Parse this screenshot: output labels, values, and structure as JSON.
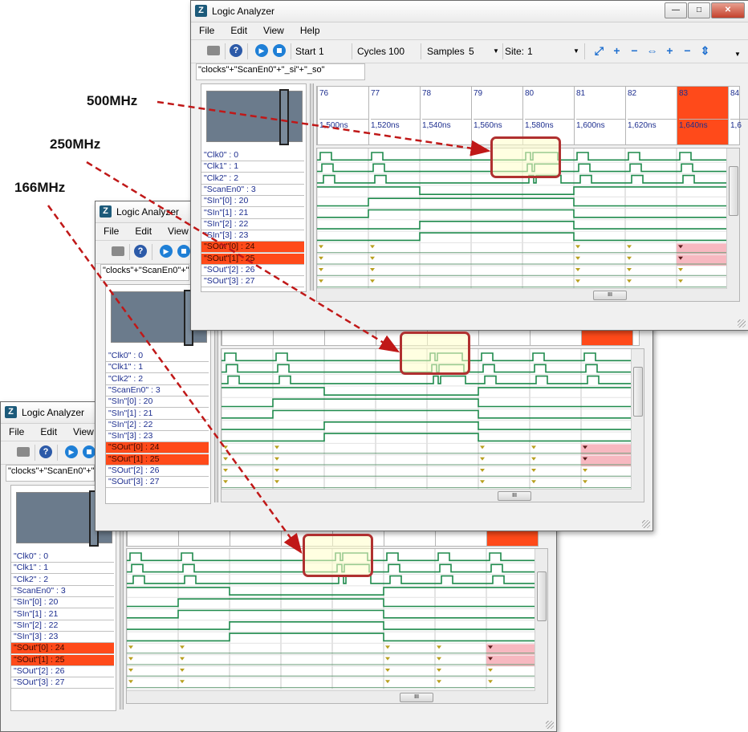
{
  "app_title": "Logic Analyzer",
  "callouts": [
    "500MHz",
    "250MHz",
    "166MHz"
  ],
  "menus": [
    "File",
    "Edit",
    "View",
    "Help"
  ],
  "toolbar": {
    "start_label": "Start",
    "start_value": "1",
    "cycles_label": "Cycles",
    "cycles_value": "100",
    "samples_label": "Samples",
    "samples_value": "5",
    "site_label": "Site:",
    "site_value": "1"
  },
  "expression": "\"clocks\"+\"ScanEn0\"+\"_si\"+\"_so\"",
  "expression_short": "\"clocks\"+\"ScanEn0\"+\"_",
  "signals": [
    "\"Clk0\" : 0",
    "\"Clk1\" : 1",
    "\"Clk2\" : 2",
    "\"ScanEn0\" : 3",
    "\"SIn\"[0] : 20",
    "\"SIn\"[1] : 21",
    "\"SIn\"[2] : 22",
    "\"SIn\"[3] : 23",
    "\"SOut\"[0] : 24",
    "\"SOut\"[1] : 25",
    "\"SOut\"[2] : 26",
    "\"SOut\"[3] : 27"
  ],
  "highlighted_signals": [
    8,
    9
  ],
  "cycles": [
    "76",
    "77",
    "78",
    "79",
    "80",
    "81",
    "82",
    "83",
    "84"
  ],
  "times": [
    "1,500ns",
    "1,520ns",
    "1,540ns",
    "1,560ns",
    "1,580ns",
    "1,600ns",
    "1,620ns",
    "1,640ns",
    "1,6"
  ],
  "selected_cycle": "83",
  "colors": {
    "trace": "#1f8a4c",
    "highlight": "#ff4a1a",
    "callout_box": "#b03030",
    "arrow": "#c01818",
    "marker": "#b8a020",
    "fail": "#f7b8c0"
  }
}
